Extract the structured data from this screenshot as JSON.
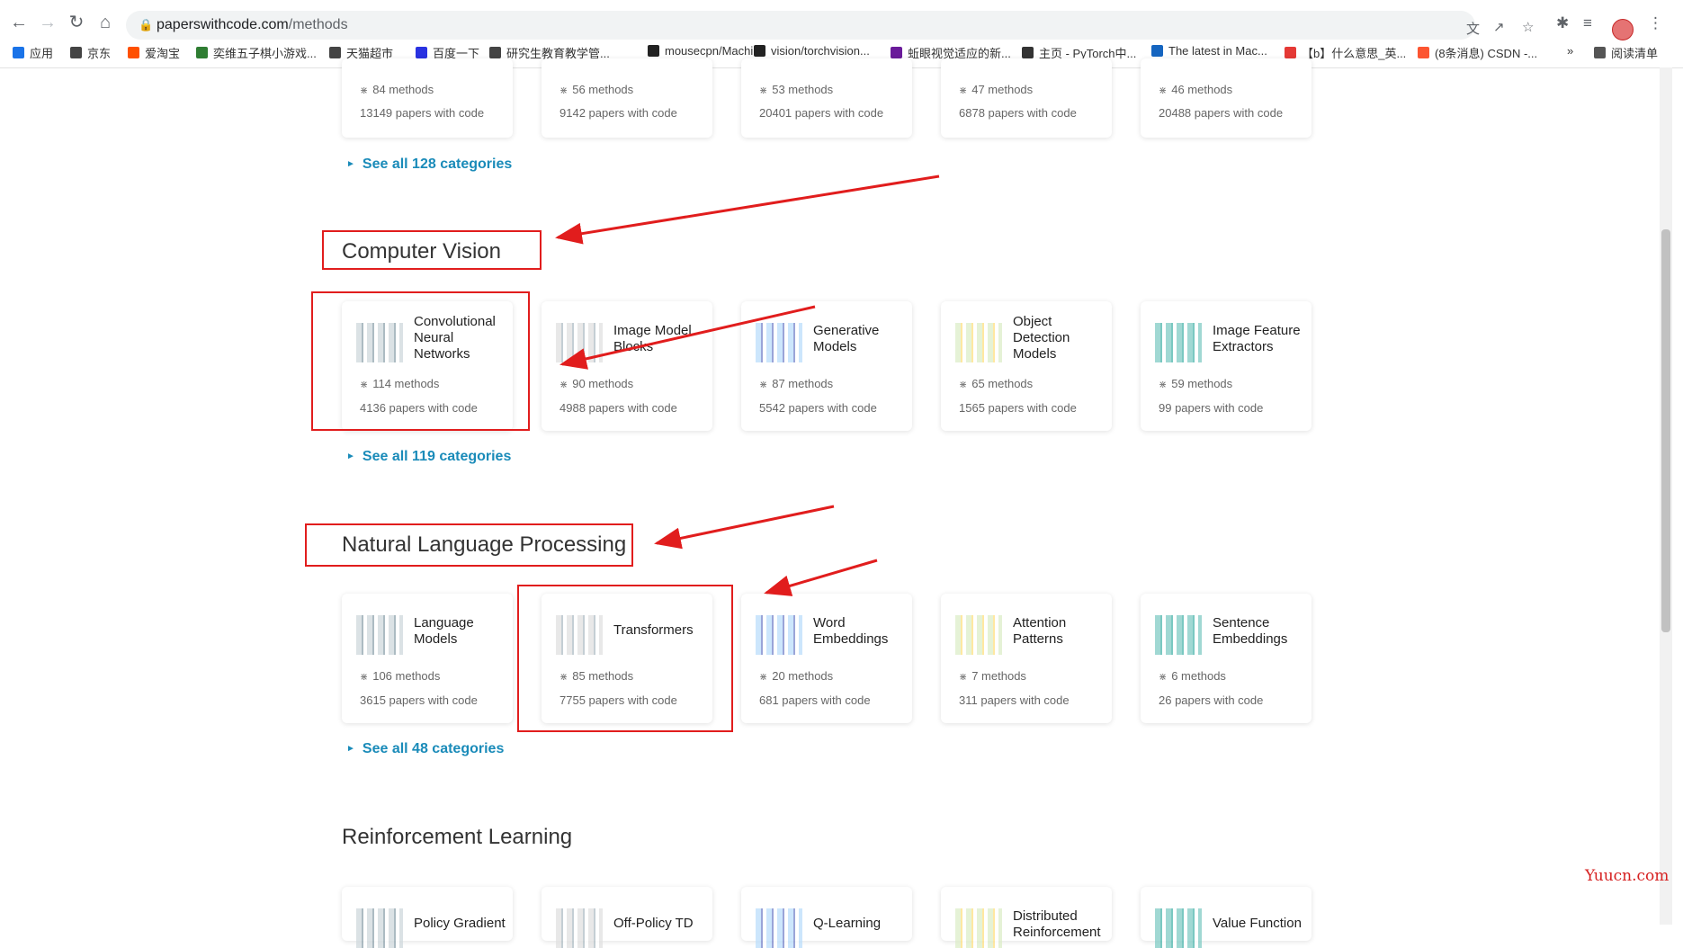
{
  "browser": {
    "url_host": "paperswithcode.com",
    "url_path": "/methods",
    "bookmarks": [
      {
        "label": "应用",
        "icon": "apps-grid-icon",
        "color": "#1a73e8"
      },
      {
        "label": "京东",
        "icon": "globe-icon",
        "color": "#444"
      },
      {
        "label": "爱淘宝",
        "icon": "taobao-icon",
        "color": "#ff5000"
      },
      {
        "label": "奕维五子棋小游戏...",
        "icon": "gomoku-icon",
        "color": "#2e7d32"
      },
      {
        "label": "天猫超市",
        "icon": "globe-icon",
        "color": "#444"
      },
      {
        "label": "百度一下",
        "icon": "baidu-icon",
        "color": "#2932e1"
      },
      {
        "label": "研究生教育教学管...",
        "icon": "globe-icon",
        "color": "#444"
      },
      {
        "label": "mousecpn/Machi...",
        "icon": "github-icon",
        "color": "#222"
      },
      {
        "label": "vision/torchvision...",
        "icon": "github-icon",
        "color": "#222"
      },
      {
        "label": "蚯眼视觉适应的新...",
        "icon": "purple-app-icon",
        "color": "#6a1b9a"
      },
      {
        "label": "主页 - PyTorch中...",
        "icon": "book-icon",
        "color": "#333"
      },
      {
        "label": "The latest in Mac...",
        "icon": "chart-icon",
        "color": "#1565c0"
      },
      {
        "label": "【b】什么意思_英...",
        "icon": "youdao-icon",
        "color": "#e53935"
      },
      {
        "label": "(8条消息) CSDN -...",
        "icon": "csdn-icon",
        "color": "#fc5531"
      }
    ],
    "overflow": "»",
    "reading_list": "阅读清单"
  },
  "top_row": [
    {
      "methods": "84 methods",
      "papers": "13149 papers with code"
    },
    {
      "methods": "56 methods",
      "papers": "9142 papers with code"
    },
    {
      "methods": "53 methods",
      "papers": "20401 papers with code"
    },
    {
      "methods": "47 methods",
      "papers": "6878 papers with code"
    },
    {
      "methods": "46 methods",
      "papers": "20488 papers with code"
    }
  ],
  "see_all_top": "See all 128 categories",
  "cv": {
    "title": "Computer Vision",
    "cards": [
      {
        "title": "Convolutional Neural Networks",
        "methods": "114 methods",
        "papers": "4136 papers with code"
      },
      {
        "title": "Image Model Blocks",
        "methods": "90 methods",
        "papers": "4988 papers with code"
      },
      {
        "title": "Generative Models",
        "methods": "87 methods",
        "papers": "5542 papers with code"
      },
      {
        "title": "Object Detection Models",
        "methods": "65 methods",
        "papers": "1565 papers with code"
      },
      {
        "title": "Image Feature Extractors",
        "methods": "59 methods",
        "papers": "99 papers with code"
      }
    ],
    "see_all": "See all 119 categories"
  },
  "nlp": {
    "title": "Natural Language Processing",
    "cards": [
      {
        "title": "Language Models",
        "methods": "106 methods",
        "papers": "3615 papers with code"
      },
      {
        "title": "Transformers",
        "methods": "85 methods",
        "papers": "7755 papers with code"
      },
      {
        "title": "Word Embeddings",
        "methods": "20 methods",
        "papers": "681 papers with code"
      },
      {
        "title": "Attention Patterns",
        "methods": "7 methods",
        "papers": "311 papers with code"
      },
      {
        "title": "Sentence Embeddings",
        "methods": "6 methods",
        "papers": "26 papers with code"
      }
    ],
    "see_all": "See all 48 categories"
  },
  "rl": {
    "title": "Reinforcement Learning",
    "cards": [
      {
        "title": "Policy Gradient"
      },
      {
        "title": "Off-Policy TD"
      },
      {
        "title": "Q-Learning"
      },
      {
        "title": "Distributed Reinforcement"
      },
      {
        "title": "Value Function"
      }
    ]
  },
  "watermark": "Yuucn.com",
  "colors": {
    "accent": "#1a8bb9",
    "annotation_red": "#e11d1d"
  }
}
